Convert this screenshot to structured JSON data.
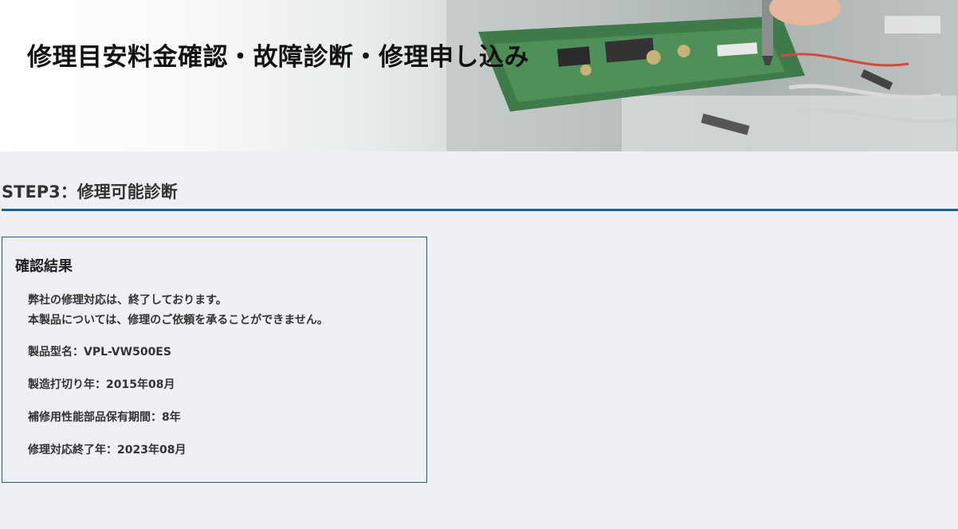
{
  "hero": {
    "title": "修理目安料金確認・故障診断・修理申し込み"
  },
  "step": {
    "heading": "STEP3：修理可能診断"
  },
  "result": {
    "title": "確認結果",
    "message_lines": [
      "弊社の修理対応は、終了しております。",
      "本製品については、修理のご依頼を承ることができません。"
    ],
    "details": [
      {
        "label": "製品型名：",
        "value": "VPL-VW500ES"
      },
      {
        "label": "製造打切り年：",
        "value": "2015年08月"
      },
      {
        "label": "補修用性能部品保有期間：",
        "value": "8年"
      },
      {
        "label": "修理対応終了年：",
        "value": "2023年08月"
      }
    ]
  },
  "colors": {
    "accent": "#1565a6",
    "page_background": "#eef0f3",
    "card_border": "#1a5f96"
  }
}
